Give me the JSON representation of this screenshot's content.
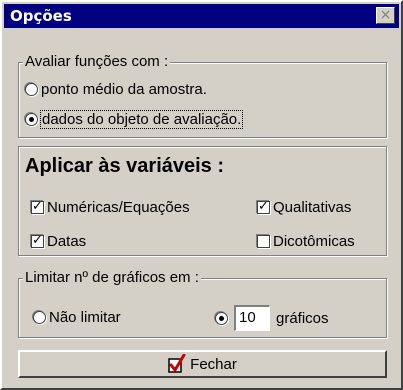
{
  "window": {
    "title": "Opções",
    "close_glyph": "×"
  },
  "group_avaliar": {
    "legend": "Avaliar funções com :",
    "options": [
      {
        "label": "ponto médio da amostra.",
        "checked": false
      },
      {
        "label": "dados do objeto de avaliação.",
        "checked": true
      }
    ]
  },
  "group_aplicar": {
    "title": "Aplicar às variáveis :",
    "checkboxes": {
      "numericas": {
        "label": "Numéricas/Equações",
        "checked": true
      },
      "qualitativas": {
        "label": "Qualitativas",
        "checked": true
      },
      "datas": {
        "label": "Datas",
        "checked": true
      },
      "dicotomicas": {
        "label": "Dicotômicas",
        "checked": false
      }
    }
  },
  "group_limitar": {
    "legend": "Limitar nº de gráficos em :",
    "nao_limitar_label": "Não limitar",
    "nao_limitar_checked": false,
    "limit_checked": true,
    "limit_value": "10",
    "graficos_label": "gráficos"
  },
  "close_button": {
    "label": "Fechar",
    "icon": "check-icon"
  },
  "colors": {
    "face": "#d4d0c8",
    "title_bar": "#000080",
    "icon_red": "#cc0000"
  }
}
